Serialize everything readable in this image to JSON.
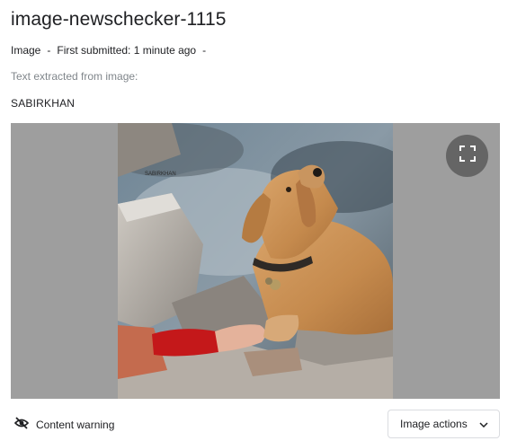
{
  "header": {
    "title": "image-newschecker-1115"
  },
  "meta": {
    "type": "Image",
    "separator": "-",
    "submitted": "First submitted: 1 minute ago"
  },
  "extraction": {
    "label": "Text extracted from image:",
    "text": "SABIRKHAN"
  },
  "viewer": {
    "watermark": "SABIRKHAN",
    "expand_icon": "fullscreen-icon"
  },
  "footer": {
    "content_warning_label": "Content warning",
    "content_warning_icon": "eye-off-icon",
    "image_actions_label": "Image actions",
    "image_actions_icon": "chevron-down-icon"
  },
  "colors": {
    "viewer_background": "#9e9e9e",
    "button_border": "#dadce0",
    "muted_text": "#80868b"
  }
}
